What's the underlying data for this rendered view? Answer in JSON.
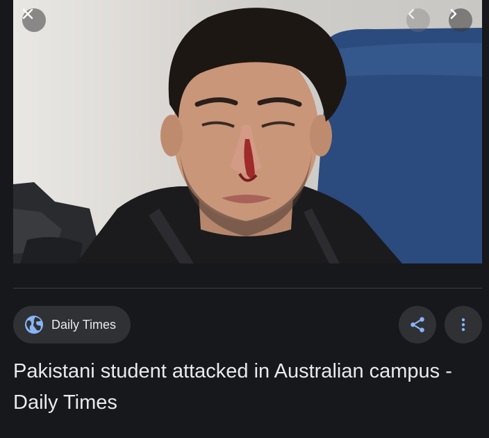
{
  "viewer": {
    "image_alt": "Pakistani student attacked in Australian campus - Daily Times",
    "close_icon": "close-icon",
    "prev_icon": "chevron-left-icon",
    "next_icon": "chevron-right-icon"
  },
  "source": {
    "icon": "globe-icon",
    "name": "Daily Times"
  },
  "actions": {
    "share_icon": "share-icon",
    "more_icon": "more-vert-icon",
    "accent": "#8ab4f8"
  },
  "result": {
    "title": "Pakistani student attacked in Australian campus - Daily Times"
  }
}
